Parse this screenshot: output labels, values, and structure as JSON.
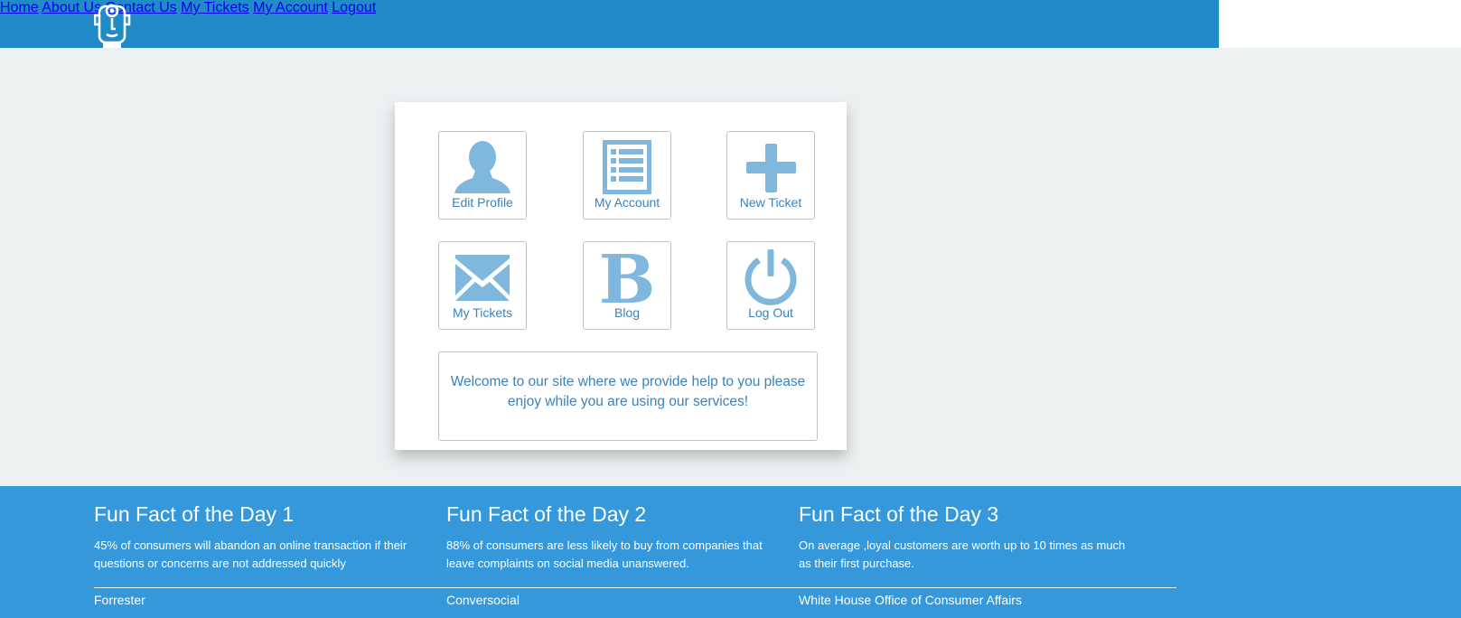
{
  "colors": {
    "topbar": "#218bc8",
    "footer": "#3498db",
    "page_bg": "#ecf0f1",
    "tile_icon": "#7fb8dc",
    "tile_text": "#3b82b8"
  },
  "header": {
    "logo_icon": "robot-face-logo",
    "nav": [
      {
        "label": "Home"
      },
      {
        "label": "About Us"
      },
      {
        "label": "Contact Us"
      },
      {
        "label": "My Tickets"
      },
      {
        "label": "My Account"
      },
      {
        "label": "Logout"
      }
    ]
  },
  "dashboard": {
    "tiles": [
      {
        "label": "Edit Profile",
        "icon": "user-icon"
      },
      {
        "label": "My Account",
        "icon": "list-icon"
      },
      {
        "label": "New Ticket",
        "icon": "plus-icon"
      },
      {
        "label": "My Tickets",
        "icon": "envelope-icon"
      },
      {
        "label": "Blog",
        "icon": "blog-b-icon"
      },
      {
        "label": "Log Out",
        "icon": "power-icon"
      }
    ],
    "welcome": "Welcome to our site where we provide help to you please enjoy while you are using our services!"
  },
  "footer": {
    "facts": [
      {
        "title": "Fun Fact of the Day 1",
        "text": "45% of consumers will abandon an online transaction if their questions or concerns are not addressed quickly",
        "source": "Forrester"
      },
      {
        "title": "Fun Fact of the Day 2",
        "text": "88% of consumers are less likely to buy from companies that leave complaints on social media unanswered.",
        "source": "Conversocial"
      },
      {
        "title": "Fun Fact of the Day 3",
        "text": "On average ,loyal customers are worth up to 10 times as much as their first purchase.",
        "source": "White House Office of Consumer Affairs"
      }
    ]
  }
}
